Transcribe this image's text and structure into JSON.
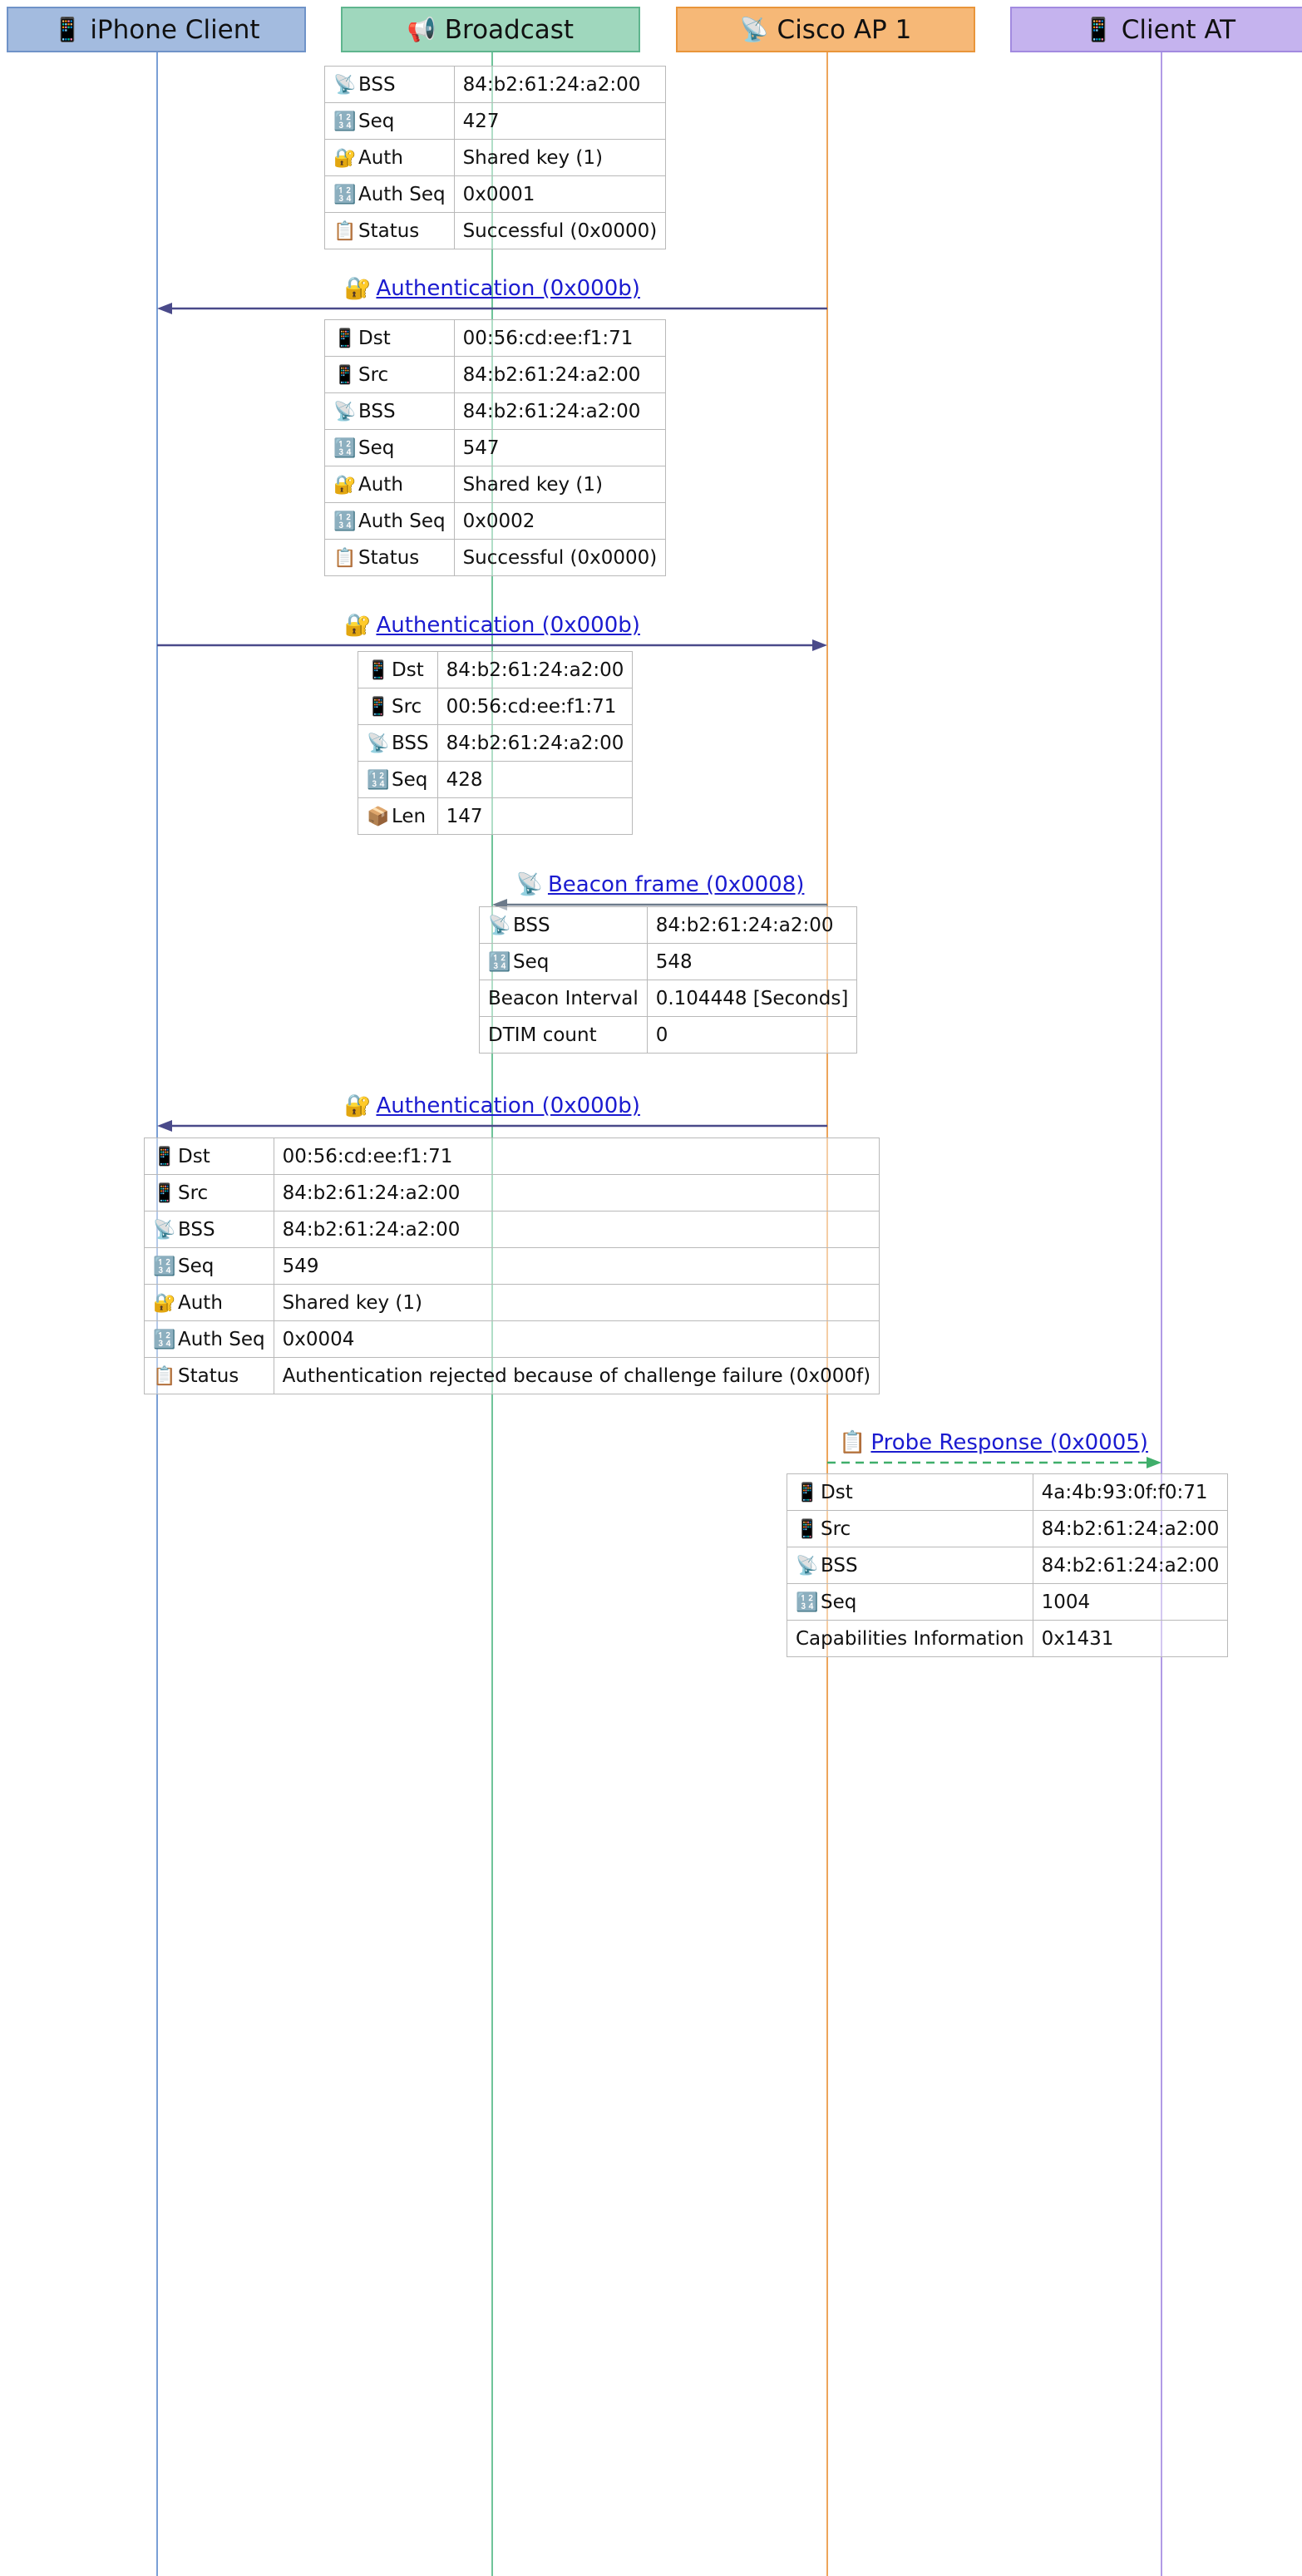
{
  "participants": [
    {
      "label": "iPhone Client",
      "icon": "📱",
      "icon_name": "phone-icon",
      "fill": "#a3bbdf",
      "stroke": "#6f93c8",
      "line": "#7a9fd6"
    },
    {
      "label": "Broadcast",
      "icon": "📢",
      "icon_name": "megaphone-icon",
      "fill": "#9fd7bd",
      "stroke": "#5fb58e",
      "line": "#6fc49a"
    },
    {
      "label": "Cisco AP 1",
      "icon": "📡",
      "icon_name": "satellite-antenna-icon",
      "fill": "#f6b877",
      "stroke": "#e9953a",
      "line": "#eda55b"
    },
    {
      "label": "Client AT",
      "icon": "📱",
      "icon_name": "phone-icon",
      "fill": "#c5b3ee",
      "stroke": "#a28ae0",
      "line": "#b19be6"
    }
  ],
  "messages": [
    {
      "label": "Authentication (0x000b)",
      "icon": "🔐",
      "icon_name": "lock-with-key-icon",
      "from": 2,
      "to": 0,
      "style": "solid",
      "color": "#4a4a8a"
    },
    {
      "label": "Authentication (0x000b)",
      "icon": "🔐",
      "icon_name": "lock-with-key-icon",
      "from": 0,
      "to": 2,
      "style": "solid",
      "color": "#4a4a8a"
    },
    {
      "label": "Beacon frame (0x0008)",
      "icon": "📡",
      "icon_name": "satellite-antenna-icon",
      "from": 2,
      "to": 1,
      "style": "solid",
      "color": "#6c7a8a"
    },
    {
      "label": "Authentication (0x000b)",
      "icon": "🔐",
      "icon_name": "lock-with-key-icon",
      "from": 2,
      "to": 0,
      "style": "solid",
      "color": "#4a4a8a"
    },
    {
      "label": "Probe Response (0x0005)",
      "icon": "📋",
      "icon_name": "clipboard-icon",
      "from": 2,
      "to": 3,
      "style": "dashed",
      "color": "#3fae6a"
    }
  ],
  "frames": [
    {
      "rows": [
        {
          "icon": "📡",
          "icon_name": "satellite-antenna-icon",
          "key": "BSS",
          "value": "84:b2:61:24:a2:00"
        },
        {
          "icon": "🔢",
          "icon_name": "numbers-icon",
          "key": "Seq",
          "value": "427"
        },
        {
          "icon": "🔐",
          "icon_name": "lock-with-key-icon",
          "key": "Auth",
          "value": "Shared key (1)"
        },
        {
          "icon": "🔢",
          "icon_name": "numbers-icon",
          "key": "Auth Seq",
          "value": "0x0001"
        },
        {
          "icon": "📋",
          "icon_name": "clipboard-icon",
          "key": "Status",
          "value": "Successful (0x0000)"
        }
      ]
    },
    {
      "rows": [
        {
          "icon": "📱",
          "icon_name": "phone-icon",
          "key": "Dst",
          "value": "00:56:cd:ee:f1:71"
        },
        {
          "icon": "📱",
          "icon_name": "phone-icon",
          "key": "Src",
          "value": "84:b2:61:24:a2:00"
        },
        {
          "icon": "📡",
          "icon_name": "satellite-antenna-icon",
          "key": "BSS",
          "value": "84:b2:61:24:a2:00"
        },
        {
          "icon": "🔢",
          "icon_name": "numbers-icon",
          "key": "Seq",
          "value": "547"
        },
        {
          "icon": "🔐",
          "icon_name": "lock-with-key-icon",
          "key": "Auth",
          "value": "Shared key (1)"
        },
        {
          "icon": "🔢",
          "icon_name": "numbers-icon",
          "key": "Auth Seq",
          "value": "0x0002"
        },
        {
          "icon": "📋",
          "icon_name": "clipboard-icon",
          "key": "Status",
          "value": "Successful (0x0000)"
        }
      ]
    },
    {
      "rows": [
        {
          "icon": "📱",
          "icon_name": "phone-icon",
          "key": "Dst",
          "value": "84:b2:61:24:a2:00"
        },
        {
          "icon": "📱",
          "icon_name": "phone-icon",
          "key": "Src",
          "value": "00:56:cd:ee:f1:71"
        },
        {
          "icon": "📡",
          "icon_name": "satellite-antenna-icon",
          "key": "BSS",
          "value": "84:b2:61:24:a2:00"
        },
        {
          "icon": "🔢",
          "icon_name": "numbers-icon",
          "key": "Seq",
          "value": "428"
        },
        {
          "icon": "📦",
          "icon_name": "package-icon",
          "key": "Len",
          "value": "147"
        }
      ]
    },
    {
      "rows": [
        {
          "icon": "📡",
          "icon_name": "satellite-antenna-icon",
          "key": "BSS",
          "value": "84:b2:61:24:a2:00"
        },
        {
          "icon": "🔢",
          "icon_name": "numbers-icon",
          "key": "Seq",
          "value": "548"
        },
        {
          "icon": "",
          "icon_name": "",
          "key": "Beacon Interval",
          "value": "0.104448 [Seconds]"
        },
        {
          "icon": "",
          "icon_name": "",
          "key": "DTIM count",
          "value": "0"
        }
      ]
    },
    {
      "rows": [
        {
          "icon": "📱",
          "icon_name": "phone-icon",
          "key": "Dst",
          "value": "00:56:cd:ee:f1:71"
        },
        {
          "icon": "📱",
          "icon_name": "phone-icon",
          "key": "Src",
          "value": "84:b2:61:24:a2:00"
        },
        {
          "icon": "📡",
          "icon_name": "satellite-antenna-icon",
          "key": "BSS",
          "value": "84:b2:61:24:a2:00"
        },
        {
          "icon": "🔢",
          "icon_name": "numbers-icon",
          "key": "Seq",
          "value": "549"
        },
        {
          "icon": "🔐",
          "icon_name": "lock-with-key-icon",
          "key": "Auth",
          "value": "Shared key (1)"
        },
        {
          "icon": "🔢",
          "icon_name": "numbers-icon",
          "key": "Auth Seq",
          "value": "0x0004"
        },
        {
          "icon": "📋",
          "icon_name": "clipboard-icon",
          "key": "Status",
          "value": "Authentication rejected because of challenge failure (0x000f)"
        }
      ]
    },
    {
      "rows": [
        {
          "icon": "📱",
          "icon_name": "phone-icon",
          "key": "Dst",
          "value": "4a:4b:93:0f:f0:71"
        },
        {
          "icon": "📱",
          "icon_name": "phone-icon",
          "key": "Src",
          "value": "84:b2:61:24:a2:00"
        },
        {
          "icon": "📡",
          "icon_name": "satellite-antenna-icon",
          "key": "BSS",
          "value": "84:b2:61:24:a2:00"
        },
        {
          "icon": "🔢",
          "icon_name": "numbers-icon",
          "key": "Seq",
          "value": "1004"
        },
        {
          "icon": "",
          "icon_name": "",
          "key": "Capabilities Information",
          "value": "0x1431"
        }
      ]
    }
  ]
}
